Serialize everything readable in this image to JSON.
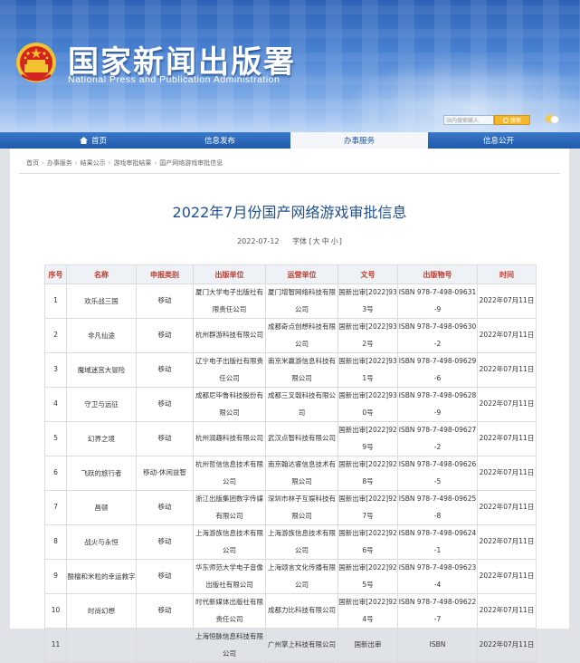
{
  "site": {
    "title": "国家新闻出版署",
    "subtitle": "National Press and Publication Administration"
  },
  "search": {
    "placeholder": "站内搜索输入",
    "button": "搜索"
  },
  "nav": [
    {
      "label": "首页"
    },
    {
      "label": "信息发布"
    },
    {
      "label": "办事服务"
    },
    {
      "label": "信息公开"
    }
  ],
  "breadcrumb": [
    "首页",
    "办事服务",
    "结果公示",
    "游戏审批结果",
    "国产网络游戏审批信息"
  ],
  "article": {
    "title": "2022年7月份国产网络游戏审批信息",
    "date": "2022-07-12",
    "font_label": "字体",
    "size_open": "[",
    "size_large": "大",
    "size_medium": "中",
    "size_small": "小",
    "size_close": "]"
  },
  "table": {
    "headers": [
      "序号",
      "名称",
      "申报类别",
      "出版单位",
      "运营单位",
      "文号",
      "出版物号",
      "时间"
    ],
    "rows": [
      [
        "1",
        "欢乐战三国",
        "移动",
        "厦门大学电子出版社有限责任公司",
        "厦门增智网络科技有限公司",
        "国新出审[2022]933号",
        "ISBN 978-7-498-09631-9",
        "2022年07月11日"
      ],
      [
        "2",
        "非凡仙途",
        "移动",
        "杭州群游科技有限公司",
        "成都奇点创想科技有限公司",
        "国新出审[2022]932号",
        "ISBN 978-7-498-09630-2",
        "2022年07月11日"
      ],
      [
        "3",
        "魔域迷宫大冒险",
        "移动",
        "辽宁电子出版社有限责任公司",
        "南京米赢游信息科技有限公司",
        "国新出审[2022]931号",
        "ISBN 978-7-498-09629-6",
        "2022年07月11日"
      ],
      [
        "4",
        "守卫与远征",
        "移动",
        "成都尼毕鲁科技股份有限公司",
        "成都三叉戟科技有限公司",
        "国新出审[2022]930号",
        "ISBN 978-7-498-09628-9",
        "2022年07月11日"
      ],
      [
        "5",
        "幻界之境",
        "移动",
        "杭州润趣科技有限公司",
        "武汉点智科技有限公司",
        "国新出审[2022]929号",
        "ISBN 978-7-498-09627-2",
        "2022年07月11日"
      ],
      [
        "6",
        "飞跃的旅行者",
        "移动-休闲益智",
        "杭州哲信信息技术有限公司",
        "南京翰达睿信息技术有限公司",
        "国新出审[2022]928号",
        "ISBN 978-7-498-09626-5",
        "2022年07月11日"
      ],
      [
        "7",
        "昌顿",
        "移动",
        "浙江出版集团数字传媒有限公司",
        "深圳市林子互娱科技有限公司",
        "国新出审[2022]927号",
        "ISBN 978-7-498-09625-8",
        "2022年07月11日"
      ],
      [
        "8",
        "战火与永恒",
        "移动",
        "上海游族信息技术有限公司",
        "上海游族信息技术有限公司",
        "国新出审[2022]926号",
        "ISBN 978-7-498-09624-1",
        "2022年07月11日"
      ],
      [
        "9",
        "酸檀和米粒的幸运救字",
        "移动",
        "华东师范大学电子音像出版社有限公司",
        "上海颂言文化传播有限公司",
        "国新出审[2022]925号",
        "ISBN 978-7-498-09623-4",
        "2022年07月11日"
      ],
      [
        "10",
        "时尚幻想",
        "移动",
        "时代新媒体出版社有限责任公司",
        "成都力比科技有限公司",
        "国新出审[2022]924号",
        "ISBN 978-7-498-09622-7",
        "2022年07月11日"
      ],
      [
        "11",
        "",
        "",
        "上海恒脉信息科技有限公司",
        "广州掌上科技有限公司",
        "国新出审",
        "ISBN",
        "2022年07月11日"
      ]
    ]
  },
  "colors": {
    "banner": "#3b72c4",
    "nav": "#1f5aab",
    "title": "#1d4f91",
    "header_text": "#c0392b"
  }
}
